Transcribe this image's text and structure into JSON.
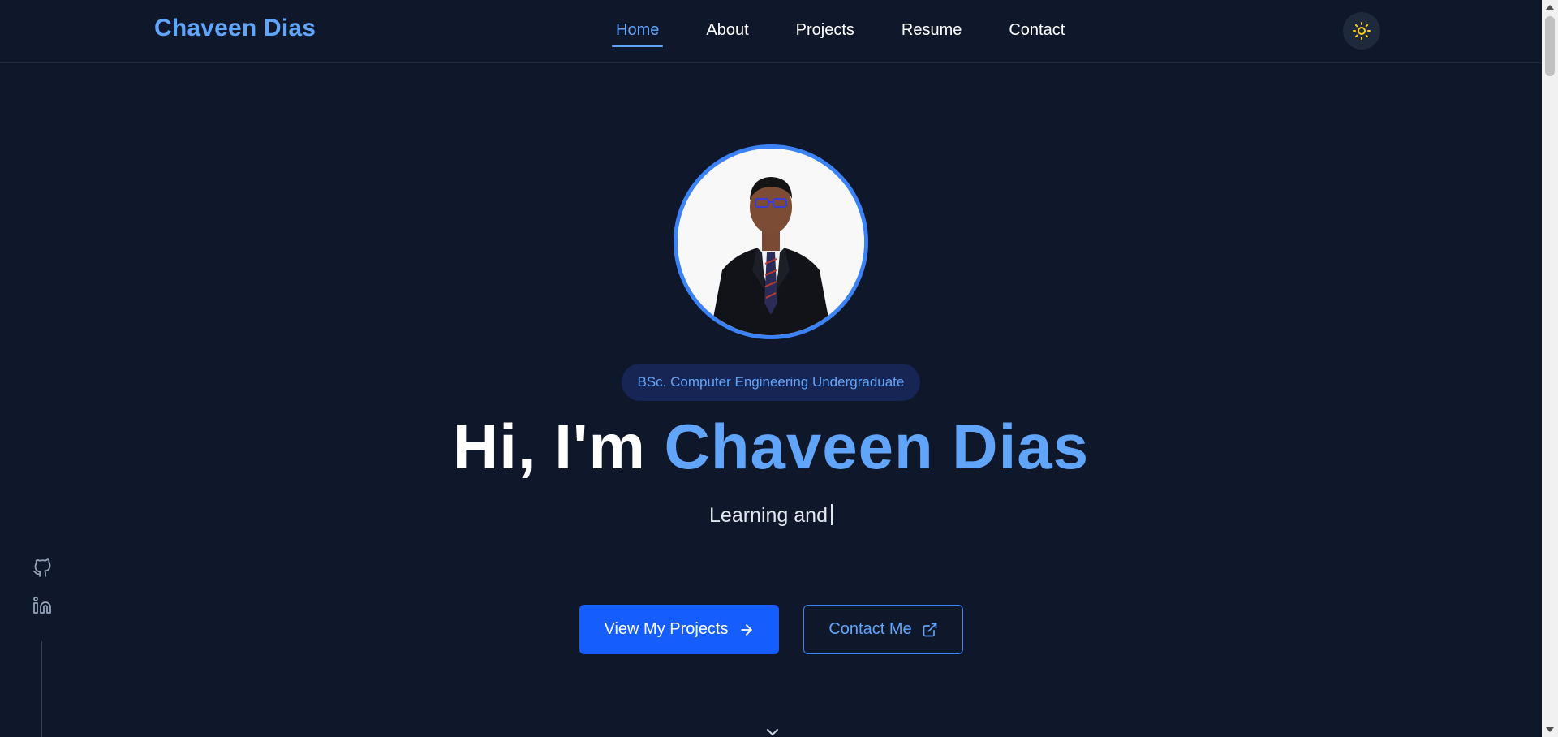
{
  "header": {
    "brand": "Chaveen Dias",
    "nav": [
      {
        "label": "Home",
        "active": true
      },
      {
        "label": "About",
        "active": false
      },
      {
        "label": "Projects",
        "active": false
      },
      {
        "label": "Resume",
        "active": false
      },
      {
        "label": "Contact",
        "active": false
      }
    ],
    "theme_toggle_icon": "sun-icon"
  },
  "hero": {
    "avatar_icon": "profile-photo",
    "badge": "BSc. Computer Engineering Undergraduate",
    "greeting": "Hi, I'm",
    "name": "Chaveen Dias",
    "typing_text": "Learning and",
    "primary_button": "View My Projects",
    "secondary_button": "Contact Me",
    "scroll_icon": "chevron-down-icon"
  },
  "social": {
    "links": [
      {
        "icon": "github-icon"
      },
      {
        "icon": "linkedin-icon"
      }
    ]
  },
  "colors": {
    "background": "#0f172a",
    "accent": "#60a5fa",
    "primary_button": "#155dfc",
    "sun": "#facc15"
  }
}
